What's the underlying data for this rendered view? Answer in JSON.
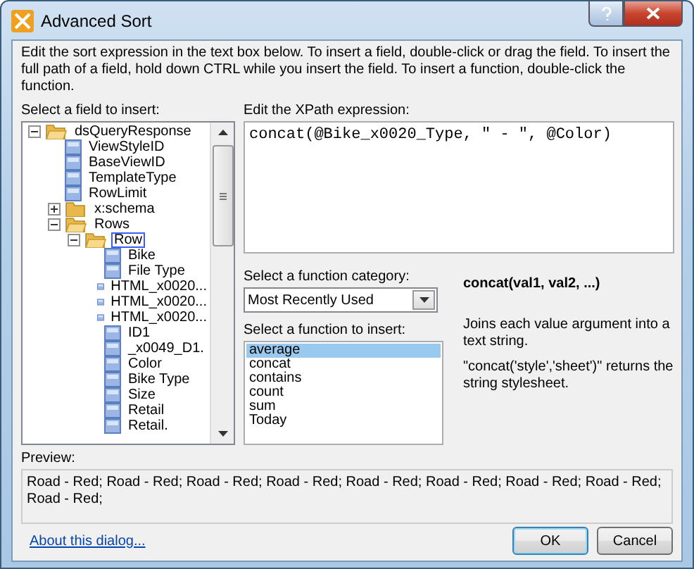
{
  "window": {
    "title": "Advanced Sort"
  },
  "instructions": "Edit the sort expression in the text box below. To insert a field, double-click or drag the field. To insert the full path of a field, hold down CTRL while you insert the field. To insert a function, double-click the function.",
  "field_tree": {
    "label": "Select a field to insert:",
    "items": [
      {
        "kind": "folder",
        "label": "dsQueryResponse",
        "expanded": true,
        "selected": false,
        "children": [
          {
            "kind": "field",
            "label": "ViewStyleID",
            "selected": false
          },
          {
            "kind": "field",
            "label": "BaseViewID",
            "selected": false
          },
          {
            "kind": "field",
            "label": "TemplateType",
            "selected": false
          },
          {
            "kind": "field",
            "label": "RowLimit",
            "selected": false
          },
          {
            "kind": "folder",
            "label": "x:schema",
            "expanded": false,
            "selected": false
          },
          {
            "kind": "folder",
            "label": "Rows",
            "expanded": true,
            "selected": false,
            "children": [
              {
                "kind": "folder",
                "label": "Row",
                "expanded": true,
                "selected": true,
                "children": [
                  {
                    "kind": "field",
                    "label": "Bike",
                    "selected": false
                  },
                  {
                    "kind": "field",
                    "label": "File Type",
                    "selected": false
                  },
                  {
                    "kind": "field",
                    "label": "HTML_x0020...",
                    "selected": false
                  },
                  {
                    "kind": "field",
                    "label": "HTML_x0020...",
                    "selected": false
                  },
                  {
                    "kind": "field",
                    "label": "HTML_x0020...",
                    "selected": false
                  },
                  {
                    "kind": "field",
                    "label": "ID1",
                    "selected": false
                  },
                  {
                    "kind": "field",
                    "label": "_x0049_D1.",
                    "selected": false
                  },
                  {
                    "kind": "field",
                    "label": "Color",
                    "selected": false
                  },
                  {
                    "kind": "field",
                    "label": "Bike Type",
                    "selected": false
                  },
                  {
                    "kind": "field",
                    "label": "Size",
                    "selected": false
                  },
                  {
                    "kind": "field",
                    "label": "Retail",
                    "selected": false
                  },
                  {
                    "kind": "field",
                    "label": "Retail.",
                    "selected": false
                  }
                ]
              }
            ]
          }
        ]
      }
    ]
  },
  "xpath": {
    "label": "Edit the XPath expression:",
    "value": "concat(@Bike_x0020_Type, \" - \", @Color)"
  },
  "category": {
    "label": "Select a function category:",
    "value": "Most Recently Used"
  },
  "functions": {
    "label": "Select a function to insert:",
    "items": [
      {
        "label": "average",
        "selected": true
      },
      {
        "label": "concat",
        "selected": false
      },
      {
        "label": "contains",
        "selected": false
      },
      {
        "label": "count",
        "selected": false
      },
      {
        "label": "sum",
        "selected": false
      },
      {
        "label": "Today",
        "selected": false
      }
    ]
  },
  "help": {
    "signature": "concat(val1, val2, ...)",
    "description": "Joins each value argument into a text string.",
    "example": "\"concat('style','sheet')\" returns the string stylesheet."
  },
  "preview": {
    "label": "Preview:",
    "value": "Road - Red; Road - Red; Road - Red; Road - Red; Road - Red; Road - Red; Road - Red; Road - Red; Road - Red;"
  },
  "about_link": "About this dialog...",
  "buttons": [
    {
      "label": "OK",
      "default": true
    },
    {
      "label": "Cancel",
      "default": false
    }
  ]
}
